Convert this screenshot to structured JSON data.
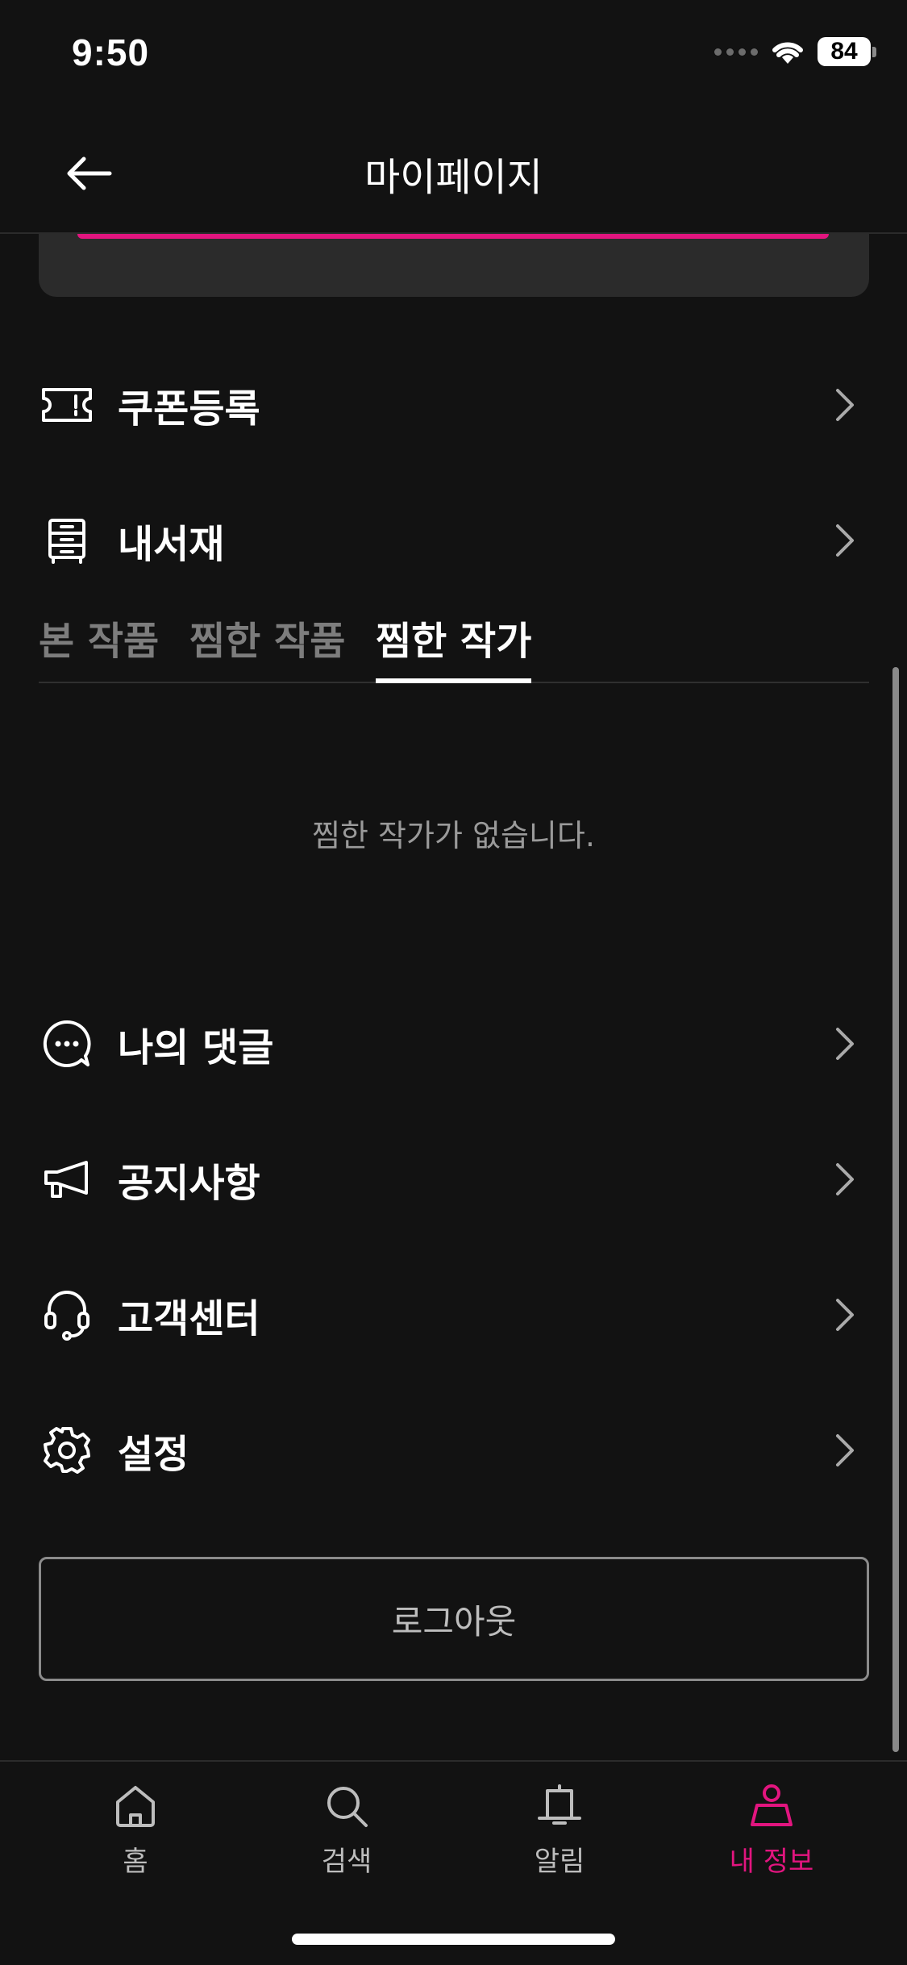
{
  "status_bar": {
    "time": "9:50",
    "battery": "84"
  },
  "header": {
    "title": "마이페이지"
  },
  "menu": {
    "coupon": "쿠폰등록",
    "library": "내서재",
    "comments": "나의 댓글",
    "notice": "공지사항",
    "support": "고객센터",
    "settings": "설정"
  },
  "tabs": [
    {
      "label": "본 작품",
      "active": false
    },
    {
      "label": "찜한 작품",
      "active": false
    },
    {
      "label": "찜한 작가",
      "active": true
    }
  ],
  "empty_message": "찜한 작가가 없습니다.",
  "logout_label": "로그아웃",
  "bottom_nav": [
    {
      "label": "홈",
      "icon": "home-icon",
      "active": false
    },
    {
      "label": "검색",
      "icon": "search-icon",
      "active": false
    },
    {
      "label": "알림",
      "icon": "bell-icon",
      "active": false
    },
    {
      "label": "내 정보",
      "icon": "person-icon",
      "active": true
    }
  ],
  "colors": {
    "accent": "#e2157f",
    "background": "#121212"
  }
}
